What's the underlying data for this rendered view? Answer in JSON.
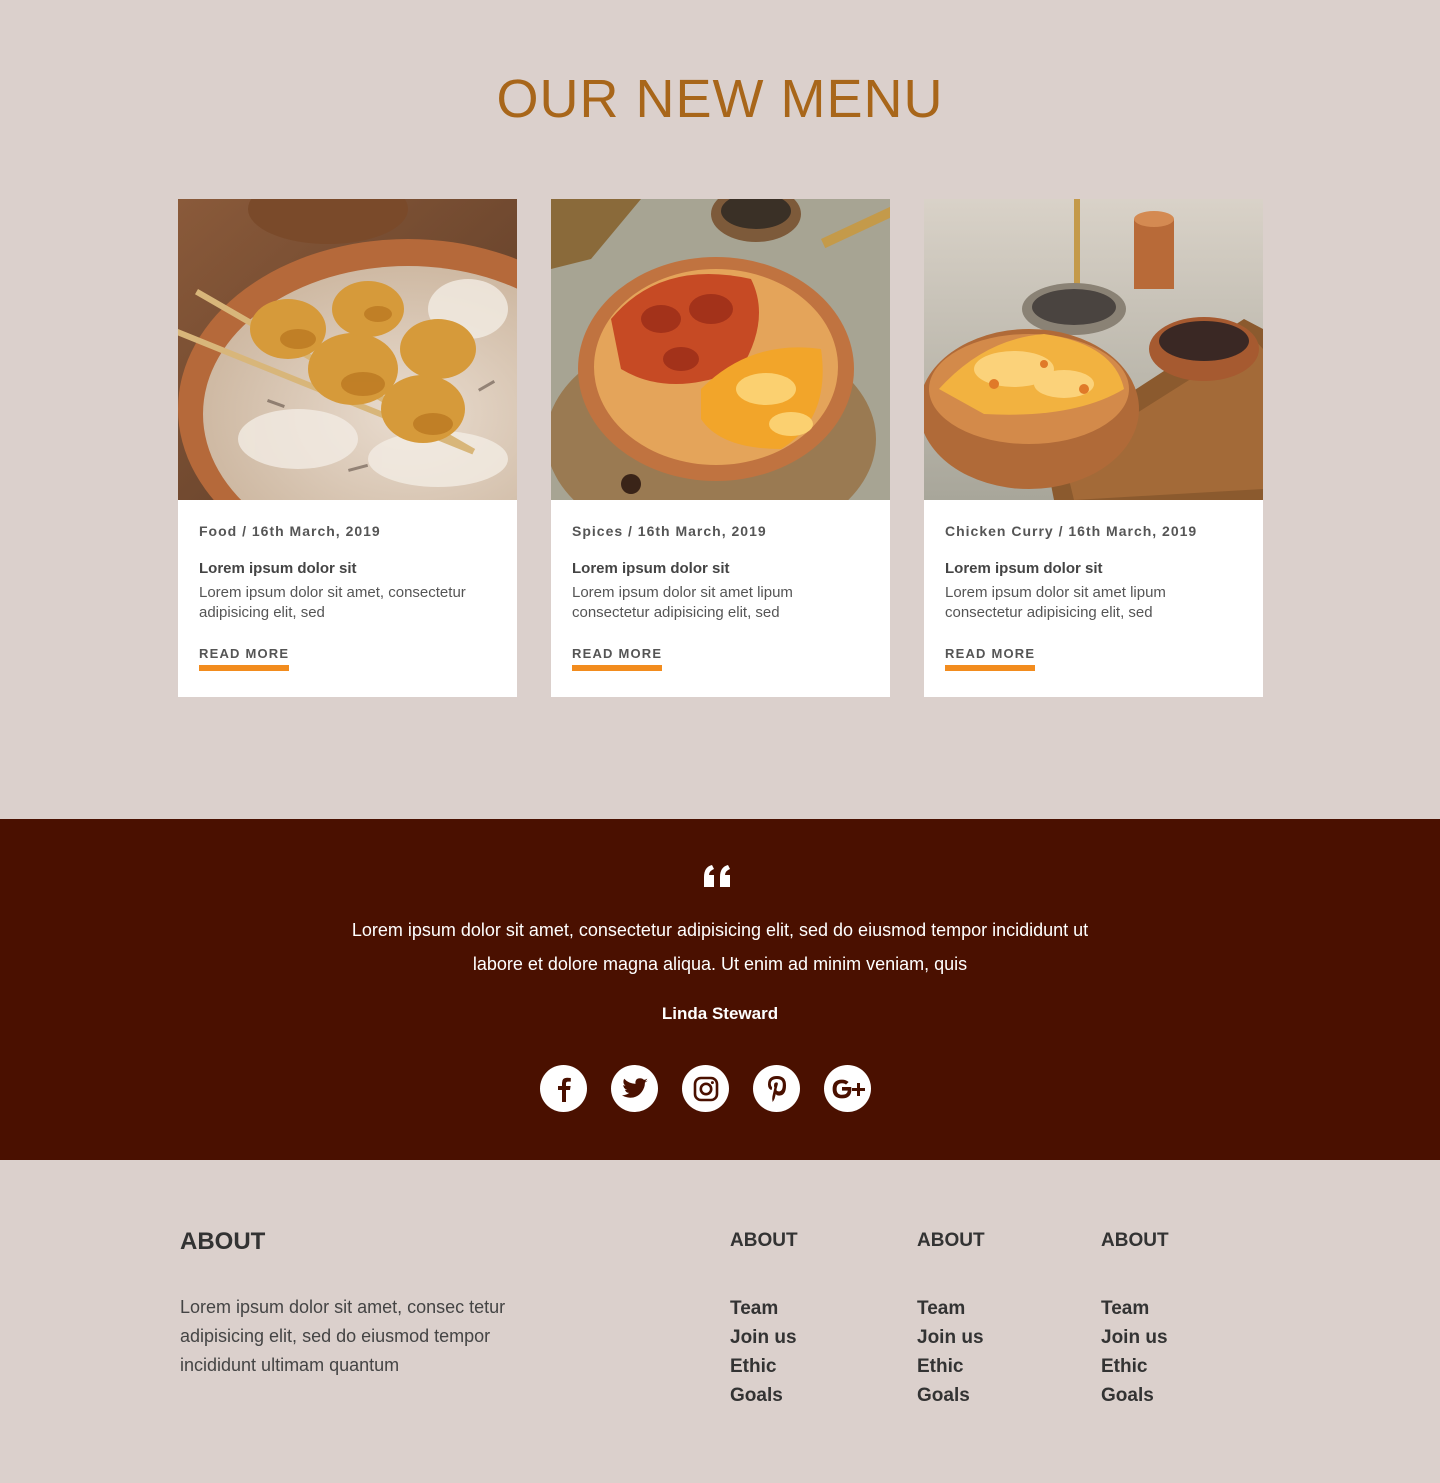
{
  "menu": {
    "title": "OUR NEW MENU",
    "cards": [
      {
        "image": "chicken-skewers-rice-photo",
        "meta": "Food / 16th March, 2019",
        "heading": "Lorem ipsum dolor sit",
        "text": "Lorem ipsum dolor sit amet, consectetur adipisicing elit, sed",
        "link": "READ MORE"
      },
      {
        "image": "curry-rice-pan-photo",
        "meta": "Spices / 16th March, 2019",
        "heading": "Lorem ipsum dolor sit",
        "text": "Lorem ipsum dolor sit amet lipum consectetur adipisicing elit, sed",
        "link": "READ MORE"
      },
      {
        "image": "rice-bowl-copper-pots-photo",
        "meta": "Chicken Curry / 16th March, 2019",
        "heading": "Lorem ipsum dolor sit",
        "text": "Lorem ipsum dolor sit amet lipum consectetur adipisicing elit, sed",
        "link": "READ MORE"
      }
    ]
  },
  "testimonial": {
    "quote_icon": "quote-icon",
    "text": "Lorem ipsum dolor sit amet, consectetur adipisicing elit, sed do eiusmod tempor incididunt ut labore et dolore magna aliqua. Ut enim ad minim veniam, quis",
    "author": "Linda Steward",
    "socials": [
      "facebook-icon",
      "twitter-icon",
      "instagram-icon",
      "pinterest-icon",
      "google-plus-icon"
    ]
  },
  "footer": {
    "about_title": "ABOUT",
    "about_text": "Lorem ipsum dolor sit amet, consec tetur adipisicing elit, sed do eiusmod tempor incididunt ultimam quantum",
    "columns": [
      {
        "title": "ABOUT",
        "links": [
          "Team",
          "Join us",
          "Ethic",
          "Goals"
        ]
      },
      {
        "title": "ABOUT",
        "links": [
          "Team",
          "Join us",
          "Ethic",
          "Goals"
        ]
      },
      {
        "title": "ABOUT",
        "links": [
          "Team",
          "Join us",
          "Ethic",
          "Goals"
        ]
      }
    ]
  },
  "colors": {
    "page_background": "#dbd0cc",
    "title_accent": "#a8661a",
    "link_underline": "#f28c1e",
    "testimonial_background": "#4a1000"
  }
}
